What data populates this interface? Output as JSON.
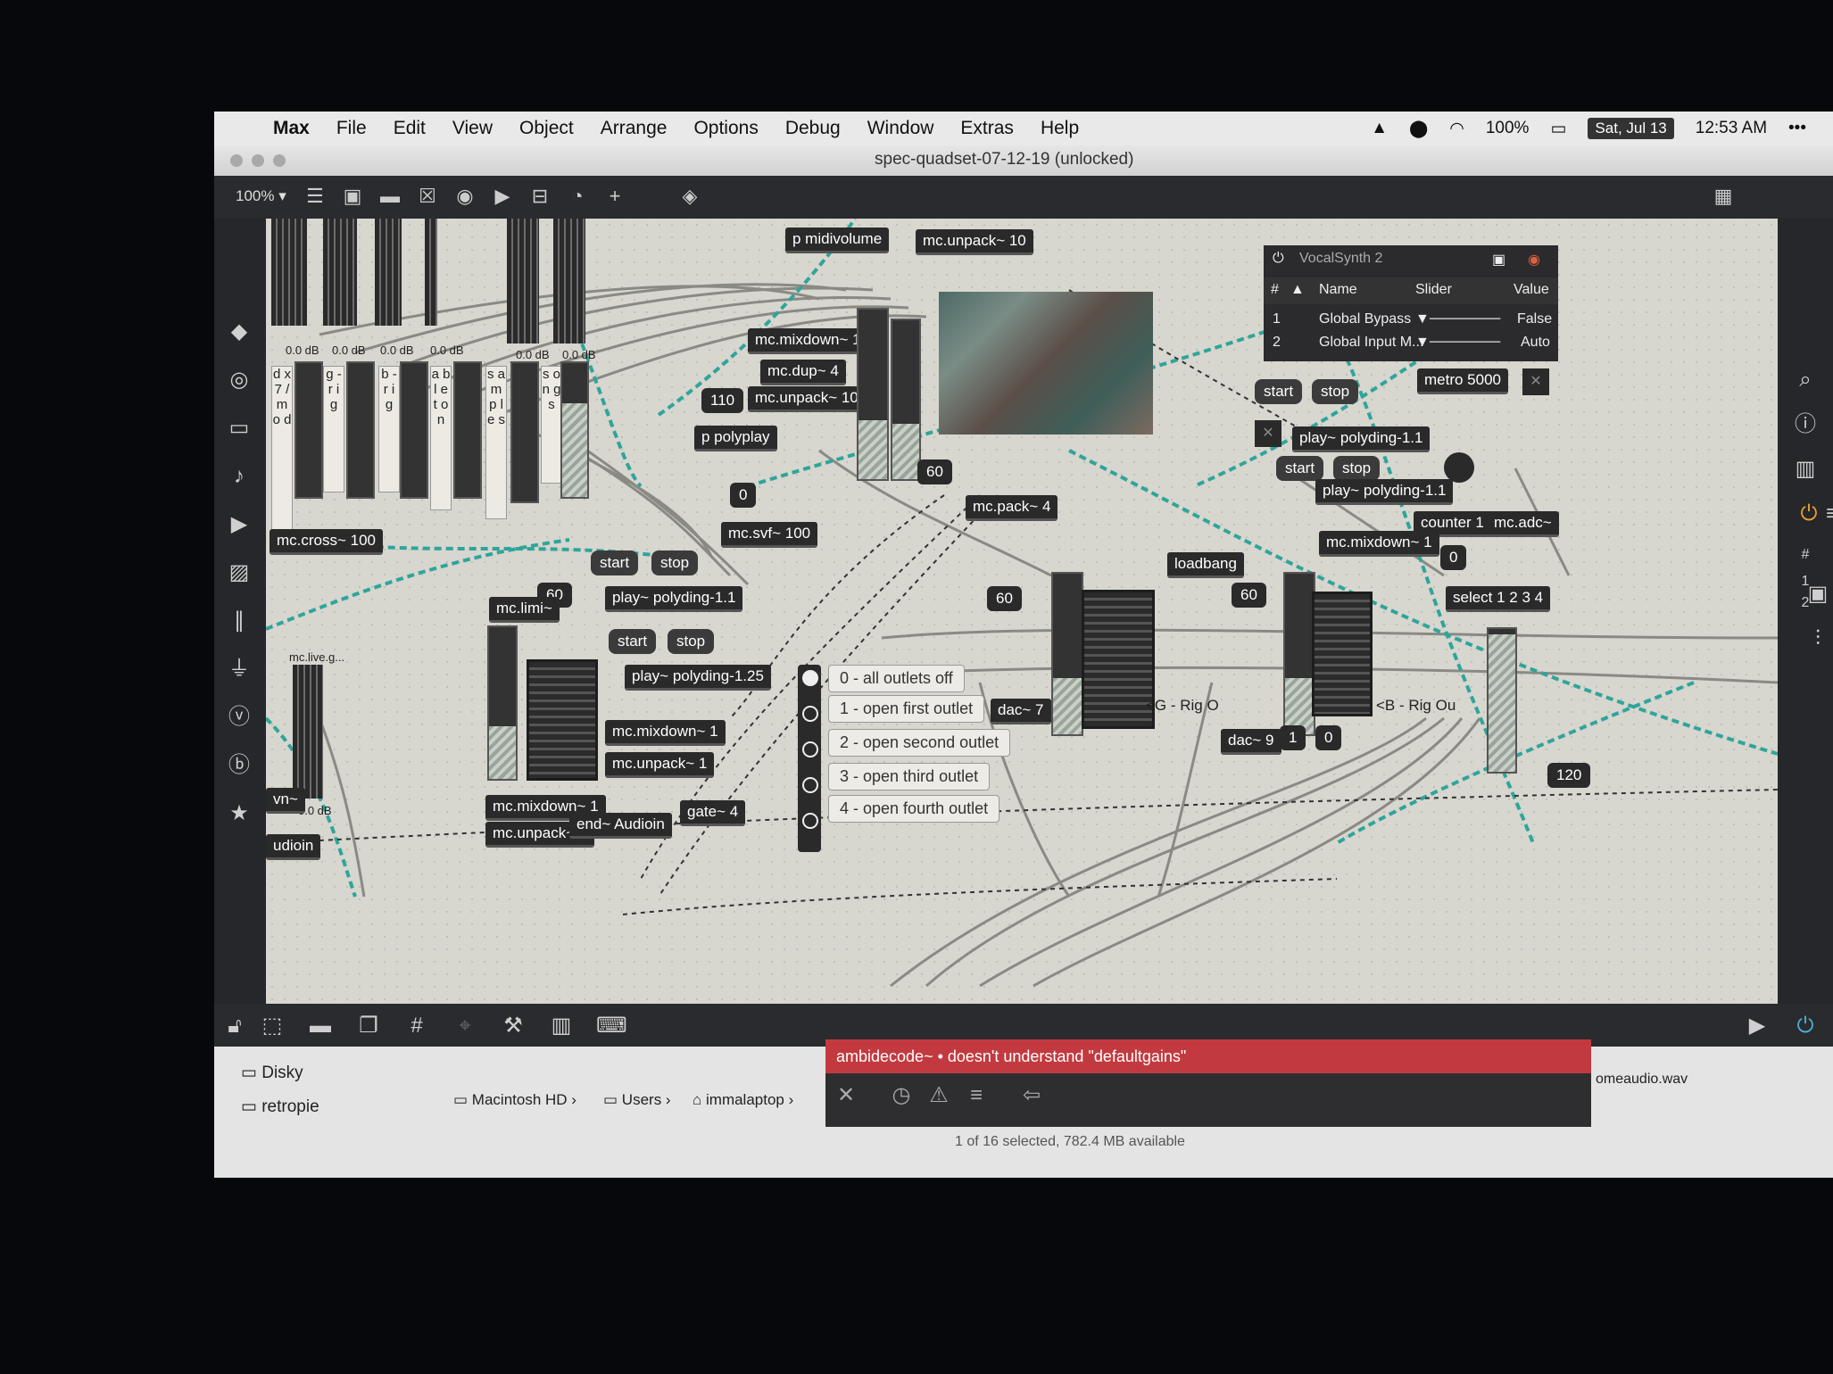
{
  "menubar": {
    "app": "Max",
    "items": [
      "File",
      "Edit",
      "View",
      "Object",
      "Arrange",
      "Options",
      "Debug",
      "Window",
      "Extras",
      "Help"
    ],
    "battery": "100%",
    "date": "Sat, Jul 13",
    "time": "12:53 AM",
    "more": "•••"
  },
  "window": {
    "title": "spec-quadset-07-12-19 (unlocked)",
    "zoom": "100% ▾"
  },
  "patcher": {
    "objects": {
      "p_midivolume": "p midivolume",
      "mc_unpack_10_top": "mc.unpack~ 10",
      "mc_mixdown_1_top": "mc.mixdown~ 1",
      "mc_dup_4": "mc.dup~ 4",
      "mc_unpack_10": "mc.unpack~ 10",
      "p_polyplay": "p polyplay",
      "mc_pack_4": "mc.pack~ 4",
      "mc_svf_100": "mc.svf~ 100",
      "mc_cross_100": "mc.cross~ 100",
      "mc_limi": "mc.limi~",
      "play_polyding_1_1a": "play~ polyding-1.1",
      "play_polyding_1_25": "play~ polyding-1.25",
      "mc_mixdown_1_mid": "mc.mixdown~ 1",
      "mc_unpack_1_mid": "mc.unpack~ 1",
      "mc_mixdown_1_bot": "mc.mixdown~ 1",
      "mc_unpack_1_bot": "mc.unpack~ 1",
      "send_audioin": "end~ Audioin",
      "gate": "gate~ 4",
      "dac_7": "dac~ 7",
      "dac_9": "dac~ 9",
      "loadbang": "loadbang",
      "play_polyding_1_1b": "play~ polyding-1.1",
      "play_polyding_1_1c": "play~ polyding-1.1",
      "metro_5000": "metro 5000",
      "counter_1_4": "counter 1 4",
      "mc_adc": "mc.adc~",
      "mc_mixdown_1_right": "mc.mixdown~ 1",
      "select_1234": "select 1 2 3 4",
      "vn_partial": "vn~",
      "udioin_partial": "udioin",
      "mc_live_gain": "mc.live.g..."
    },
    "messages": {
      "start_1": "start",
      "stop_1": "stop",
      "start_2": "start",
      "stop_2": "stop",
      "start_3": "start",
      "stop_3": "stop",
      "start_4": "start",
      "stop_4": "stop"
    },
    "numbers": {
      "n110": "110",
      "n0_a": "0",
      "n60_a": "60",
      "n60_b": "60",
      "n60_c": "60",
      "n60_d": "60",
      "n1": "1",
      "n0_b": "0",
      "n0_c": "0",
      "n120": "120"
    },
    "channel_labels": [
      "d x 7 / m o d",
      "g - r i g",
      "b - r i g",
      "a b l e t o n",
      "s a m p l e s",
      "s o n g s"
    ],
    "db_labels": [
      "0.0 dB",
      "0.0 dB",
      "0.0 dB",
      "0.0 dB",
      "0.0 dB",
      "0.0 dB",
      "0.0 dB"
    ],
    "gate_outlets": [
      "0 - all outlets off",
      "1 - open first outlet",
      "2 - open second outlet",
      "3 - open third outlet",
      "4 - open fourth outlet"
    ],
    "rig_labels": {
      "g": "<G - Rig O",
      "b": "<B - Rig Ou"
    }
  },
  "vocalsynth": {
    "title": "VocalSynth 2",
    "columns": [
      "#",
      "▲",
      "Name",
      "Slider",
      "Value"
    ],
    "rows": [
      {
        "index": "1",
        "name": "Global Bypass",
        "value": "False"
      },
      {
        "index": "2",
        "name": "Global Input M...",
        "value": "Auto"
      }
    ]
  },
  "right_panel": {
    "hash": "#",
    "rows": [
      "1",
      "2"
    ]
  },
  "console": {
    "error": "ambidecode~ • doesn't understand \"defaultgains\""
  },
  "finder": {
    "sidebar": [
      "Disky",
      "retropie"
    ],
    "path": [
      "Macintosh HD",
      "Users",
      "immalaptop"
    ],
    "status": "1 of 16 selected, 782.4 MB available",
    "file_partial": "omeaudio.wav"
  },
  "colors": {
    "accent_wire": "#2fa59a",
    "error": "#c23a3f"
  }
}
